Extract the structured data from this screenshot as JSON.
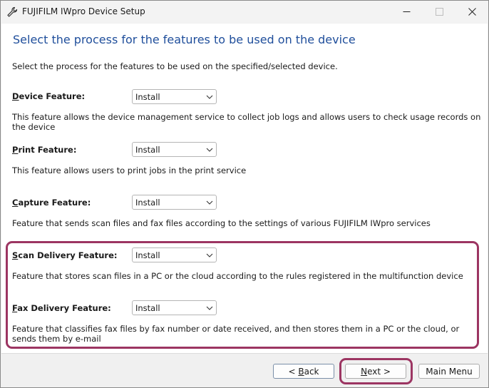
{
  "window": {
    "title": "FUJIFILM IWpro Device Setup",
    "app_icon": "wrench-icon"
  },
  "page": {
    "heading": "Select the process for the features to be used on the device",
    "intro": "Select the process for the features to be used on the specified/selected device."
  },
  "features": [
    {
      "mnemonic": "D",
      "label_rest": "evice Feature:",
      "value": "Install",
      "description": "This feature allows the device management service to collect job logs and allows users to check usage records on the device"
    },
    {
      "mnemonic": "P",
      "label_rest": "rint Feature:",
      "value": "Install",
      "description": "This feature allows users to print jobs in the print service"
    },
    {
      "mnemonic": "C",
      "label_rest": "apture Feature:",
      "value": "Install",
      "description": "Feature that sends scan files and fax files according to the settings of various FUJIFILM IWpro services"
    },
    {
      "mnemonic": "S",
      "label_rest": "can Delivery Feature:",
      "value": "Install",
      "description": "Feature that stores scan files in a PC or the cloud according to the rules registered in the multifunction device"
    },
    {
      "mnemonic": "F",
      "label_rest": "ax Delivery Feature:",
      "value": "Install",
      "description": "Feature that classifies fax files by fax number or date received, and then stores them in a PC or the cloud, or sends them by e-mail"
    }
  ],
  "buttons": {
    "back_prefix": "< ",
    "back_mnemonic": "B",
    "back_rest": "ack",
    "next_mnemonic": "N",
    "next_rest": "ext >",
    "main_menu": "Main Menu"
  },
  "colors": {
    "highlight": "#9c3562",
    "heading": "#1f4e9b"
  }
}
